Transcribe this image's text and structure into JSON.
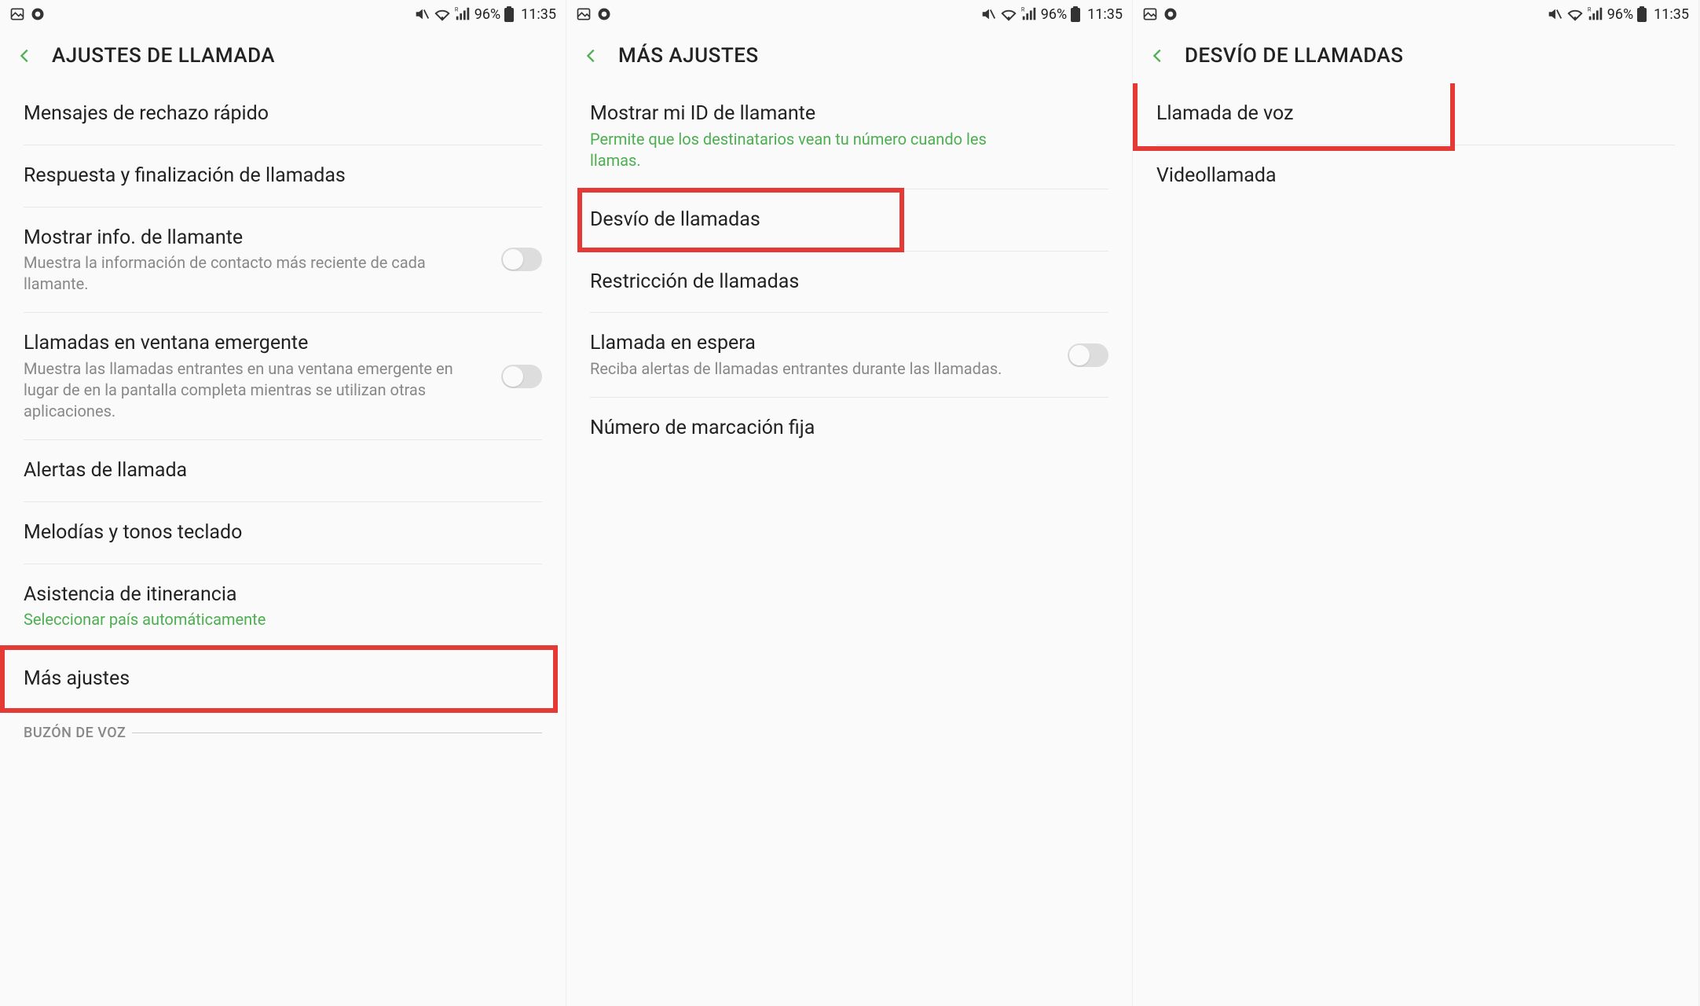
{
  "status": {
    "battery_pct": "96%",
    "time": "11:35"
  },
  "screen1": {
    "title": "AJUSTES DE LLAMADA",
    "items": {
      "rechazo": "Mensajes de rechazo rápido",
      "respuesta": "Respuesta y finalización de llamadas",
      "mostrar_info": "Mostrar info. de llamante",
      "mostrar_info_sub": "Muestra la información de contacto más reciente de cada llamante.",
      "ventana": "Llamadas en ventana emergente",
      "ventana_sub": "Muestra las llamadas entrantes en una ventana emergente en lugar de en la pantalla completa mientras se utilizan otras aplicaciones.",
      "alertas": "Alertas de llamada",
      "melodias": "Melodías y tonos teclado",
      "itinerancia": "Asistencia de itinerancia",
      "itinerancia_sub": "Seleccionar país automáticamente",
      "mas_ajustes": "Más ajustes",
      "buzon": "BUZÓN DE VOZ"
    }
  },
  "screen2": {
    "title": "MÁS AJUSTES",
    "items": {
      "id_llamante": "Mostrar mi ID de llamante",
      "id_llamante_sub": "Permite que los destinatarios vean tu número cuando les llamas.",
      "desvio": "Desvío de llamadas",
      "restriccion": "Restricción de llamadas",
      "espera": "Llamada en espera",
      "espera_sub": "Reciba alertas de llamadas entrantes durante las llamadas.",
      "marcacion": "Número de marcación fija"
    }
  },
  "screen3": {
    "title": "DESVÍO DE LLAMADAS",
    "items": {
      "voz": "Llamada de voz",
      "video": "Videollamada"
    }
  }
}
